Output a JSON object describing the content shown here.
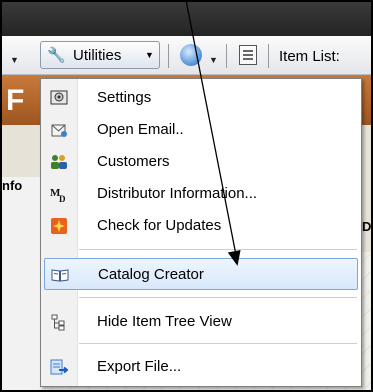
{
  "toolbar": {
    "utilities_label": "Utilities",
    "item_list_label": "Item List:"
  },
  "menu": {
    "items": [
      {
        "label": "Settings",
        "icon": "settings-icon"
      },
      {
        "label": "Open Email..",
        "icon": "email-icon"
      },
      {
        "label": "Customers",
        "icon": "customers-icon"
      },
      {
        "label": "Distributor Information...",
        "icon": "distributor-info-icon"
      },
      {
        "label": "Check for Updates",
        "icon": "updates-icon"
      },
      {
        "label": "Catalog Creator",
        "icon": "catalog-book-icon",
        "highlighted": true
      },
      {
        "label": "Hide Item Tree View",
        "icon": "tree-view-icon"
      },
      {
        "label": "Export File...",
        "icon": "export-icon"
      }
    ]
  },
  "background": {
    "left_tab_label": "nfo",
    "orange_letter": "F",
    "right_letter": "D"
  },
  "colors": {
    "highlight_border": "#7ea6de",
    "orange_strip": "#b86a2e",
    "annotation_arrow": "#000000"
  }
}
